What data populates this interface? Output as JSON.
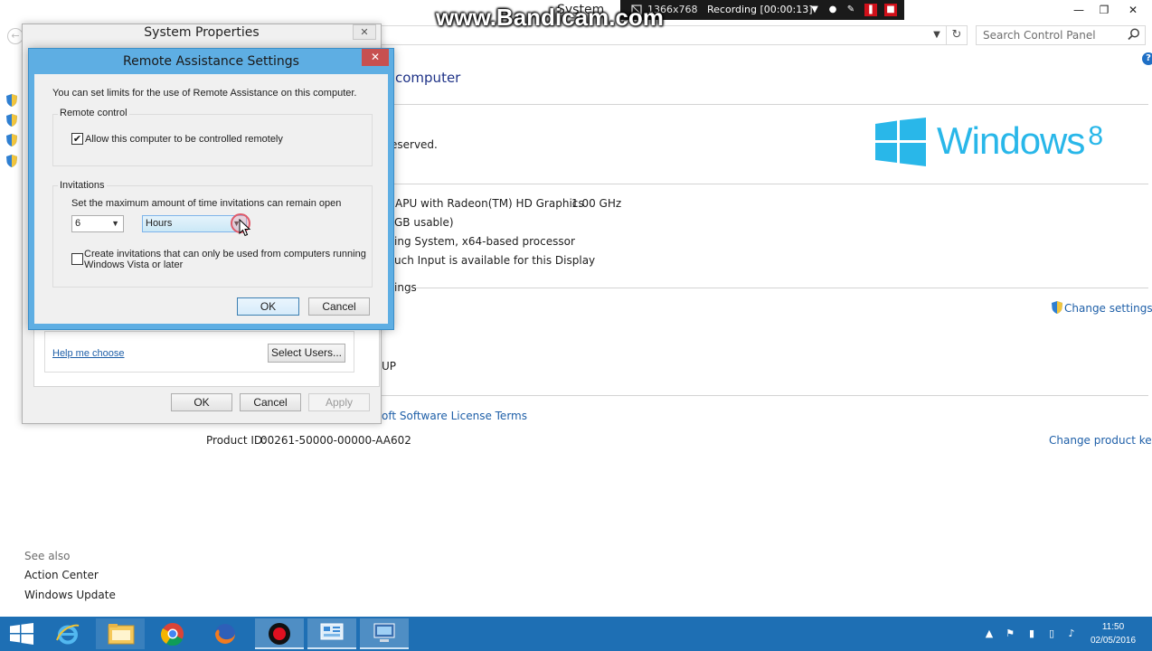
{
  "system_window": {
    "title": "System",
    "search_placeholder": "Search Control Panel",
    "heading": "computer",
    "copyright_fragment": "eserved.",
    "processor": "APU with Radeon(TM) HD Graphics",
    "processor_speed": "1.00 GHz",
    "ram_fragment": "GB usable)",
    "system_type": "ing System, x64-based processor",
    "pen_touch": "uch Input is available for this Display",
    "section_settings": "ings",
    "change_settings": "Change settings",
    "workgroup_fragment": "UP",
    "license_link": "oft Software License Terms",
    "product_id_label": "Product ID:",
    "product_id": "00261-50000-00000-AA602",
    "change_product_key": "Change product key",
    "windows_brand": "Windows",
    "windows_version": "8",
    "see_also": "See also",
    "see_also_links": [
      "Action Center",
      "Windows Update"
    ]
  },
  "recorder": {
    "watermark": "www.Bandicam.com",
    "resolution": "1366x768",
    "status": "Recording [00:00:13]"
  },
  "system_properties": {
    "title": "System Properties",
    "help_link": "Help me choose",
    "select_users": "Select Users...",
    "ok": "OK",
    "cancel": "Cancel",
    "apply": "Apply"
  },
  "remote_assistance": {
    "title": "Remote Assistance Settings",
    "intro": "You can set limits for the use of Remote Assistance on this computer.",
    "remote_control_group": "Remote control",
    "allow_remote_control": "Allow this computer to be controlled remotely",
    "allow_remote_control_checked": true,
    "invitations_group": "Invitations",
    "max_time_label": "Set the maximum amount of time invitations can remain open",
    "time_value": "6",
    "time_unit": "Hours",
    "vista_only_line1": "Create invitations that can only be used from computers running",
    "vista_only_line2": "Windows Vista or later",
    "vista_only_checked": false,
    "ok": "OK",
    "cancel": "Cancel"
  },
  "taskbar": {
    "time": "11:50",
    "date": "02/05/2016"
  },
  "colors": {
    "taskbar": "#1e6fb4",
    "dialog_frame": "#5eaee3",
    "close_button": "#c75050",
    "windows_logo": "#29b7e9",
    "link": "#1e5fa8"
  }
}
